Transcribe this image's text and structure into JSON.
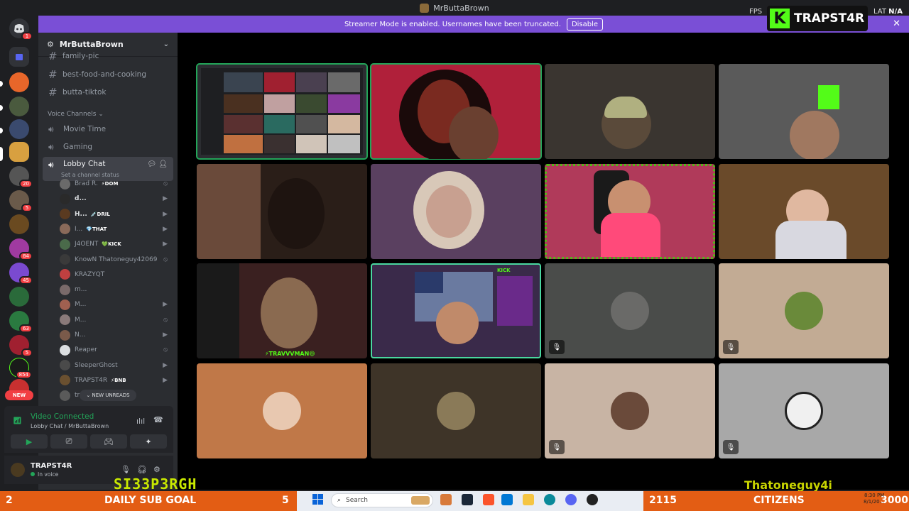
{
  "window": {
    "title": "MrButtaBrown"
  },
  "overlay": {
    "fps_label": "FPS",
    "lat_label": "LAT",
    "lat_value": "N/A",
    "kick_letter": "K",
    "kick_name": "TRAPST4R",
    "left_name": "SI33P3RGH",
    "right_name": "Thatoneguy4i"
  },
  "banner": {
    "text": "Streamer Mode is enabled. Usernames have been truncated.",
    "button": "Disable",
    "close": "✕"
  },
  "rail": {
    "badges": [
      "1",
      "20",
      "5",
      "84",
      "45",
      "63",
      "5",
      "854"
    ],
    "new_label": "NEW"
  },
  "server": {
    "name": "MrButtaBrown"
  },
  "channels": {
    "text": [
      "family-pic",
      "best-food-and-cooking",
      "butta-tiktok"
    ],
    "voice_section": "Voice Channels",
    "voice": [
      "Movie Time",
      "Gaming"
    ],
    "active": {
      "name": "Lobby Chat",
      "status": "Set a channel status"
    }
  },
  "members": [
    {
      "name": "Brad R.",
      "tag": "⚡DOM",
      "bold": false,
      "state": "deafened"
    },
    {
      "name": "d...",
      "tag": "",
      "bold": true,
      "state": "video"
    },
    {
      "name": "H...",
      "tag": "💉DRIL",
      "bold": true,
      "state": "video"
    },
    {
      "name": "I...",
      "tag": "💎THAT",
      "bold": false,
      "state": "video"
    },
    {
      "name": "J4OENT",
      "tag": "💚KICK",
      "bold": false,
      "state": "video"
    },
    {
      "name": "KnowN Thatoneguy42069",
      "tag": "",
      "bold": false,
      "state": "deafened"
    },
    {
      "name": "KRAZYQT",
      "tag": "",
      "bold": false,
      "state": ""
    },
    {
      "name": "m...",
      "tag": "",
      "bold": false,
      "state": ""
    },
    {
      "name": "M...",
      "tag": "",
      "bold": false,
      "state": "video"
    },
    {
      "name": "M...",
      "tag": "",
      "bold": false,
      "state": "deafened"
    },
    {
      "name": "N...",
      "tag": "",
      "bold": false,
      "state": "video"
    },
    {
      "name": "Reaper",
      "tag": "",
      "bold": false,
      "state": "deafened"
    },
    {
      "name": "SleeperGhost",
      "tag": "",
      "bold": false,
      "state": "video"
    },
    {
      "name": "TRAPST4R",
      "tag": "⚡BNB",
      "bold": false,
      "state": "video"
    },
    {
      "name": "travvvman",
      "tag": "",
      "bold": false,
      "state": ""
    }
  ],
  "new_unreads": "NEW UNREADS",
  "voice_panel": {
    "status": "Video Connected",
    "location": "Lobby Chat / MrButtaBrown"
  },
  "user": {
    "name": "TRAPST4R",
    "status": "In voice"
  },
  "tiles": {
    "travvvman_label": "⚡TRAVVVMAN😄",
    "kick_label": "KICK"
  },
  "bottom": {
    "sub_left": "2",
    "sub_goal": "DAILY SUB GOAL",
    "sub_right": "5",
    "cit_left": "2115",
    "cit_label": "CITIZENS",
    "cit_right": "3000",
    "search_placeholder": "Search",
    "time": "8:30 PM",
    "date": "8/1/20..."
  },
  "colors": {
    "discord_green": "#23a559",
    "banner_purple": "#7a4fd6",
    "bar_orange": "#e35d14",
    "kick_green": "#53fc18"
  }
}
